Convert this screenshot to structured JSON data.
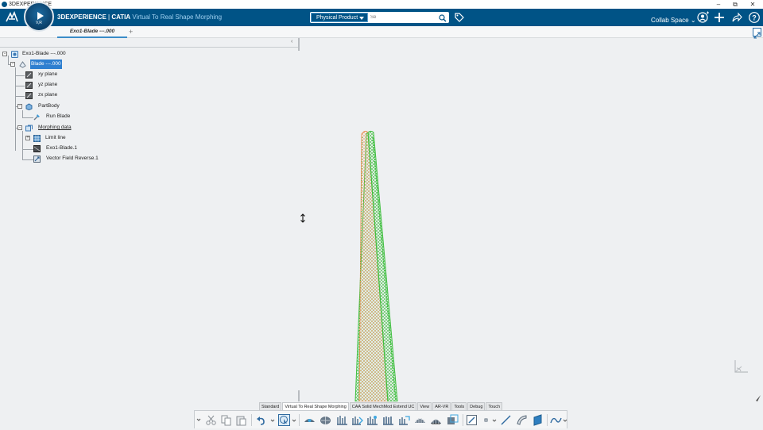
{
  "os": {
    "title": "3DEXPERIENCE",
    "minimize": "–",
    "restore": "⧉",
    "close": "✕"
  },
  "header": {
    "brand_bold": "3DEXPERIENCE",
    "brand_sep": " | ",
    "brand_app": "CATIA",
    "brand_tail": " Virtual To Real Shape Morphing",
    "compass_label": "V,R",
    "search_scope": "Physical Product",
    "search_placeholder": "Se",
    "collab_space": "Collab Space",
    "accent": "#005386"
  },
  "tabs": {
    "doc_tab": "Exo1-Blade ---.000",
    "add": "+"
  },
  "tree": {
    "collapse": "‹",
    "nodes": [
      {
        "label": "Exo1-Blade ---.000",
        "icon": "product-icon"
      },
      {
        "label": "Blade ---.000",
        "icon": "part-icon",
        "selected": true
      },
      {
        "label": "xy plane",
        "icon": "plane-icon"
      },
      {
        "label": "yz plane",
        "icon": "plane-icon"
      },
      {
        "label": "zx plane",
        "icon": "plane-icon"
      },
      {
        "label": "PartBody",
        "icon": "body-icon"
      },
      {
        "label": "Run Blade",
        "icon": "feature-icon"
      },
      {
        "label": "Morphing data",
        "icon": "set-icon"
      },
      {
        "label": "Limit line",
        "icon": "grid-icon"
      },
      {
        "label": "Exo1-Blade.1",
        "icon": "mesh-icon"
      },
      {
        "label": "Vector Field Reverse.1",
        "icon": "vector-icon"
      }
    ]
  },
  "section_tabs": [
    "Standard",
    "Virtual To Real Shape Morphing",
    "CAA Solid MechMod Extend UC",
    "View",
    "AR-VR",
    "Tools",
    "Debug",
    "Touch"
  ],
  "active_section": "Virtual To Real Shape Morphing",
  "colors": {
    "blade_orange": "#e8935a",
    "blade_green": "#3fbf3f",
    "selection": "#2e7fd0"
  }
}
